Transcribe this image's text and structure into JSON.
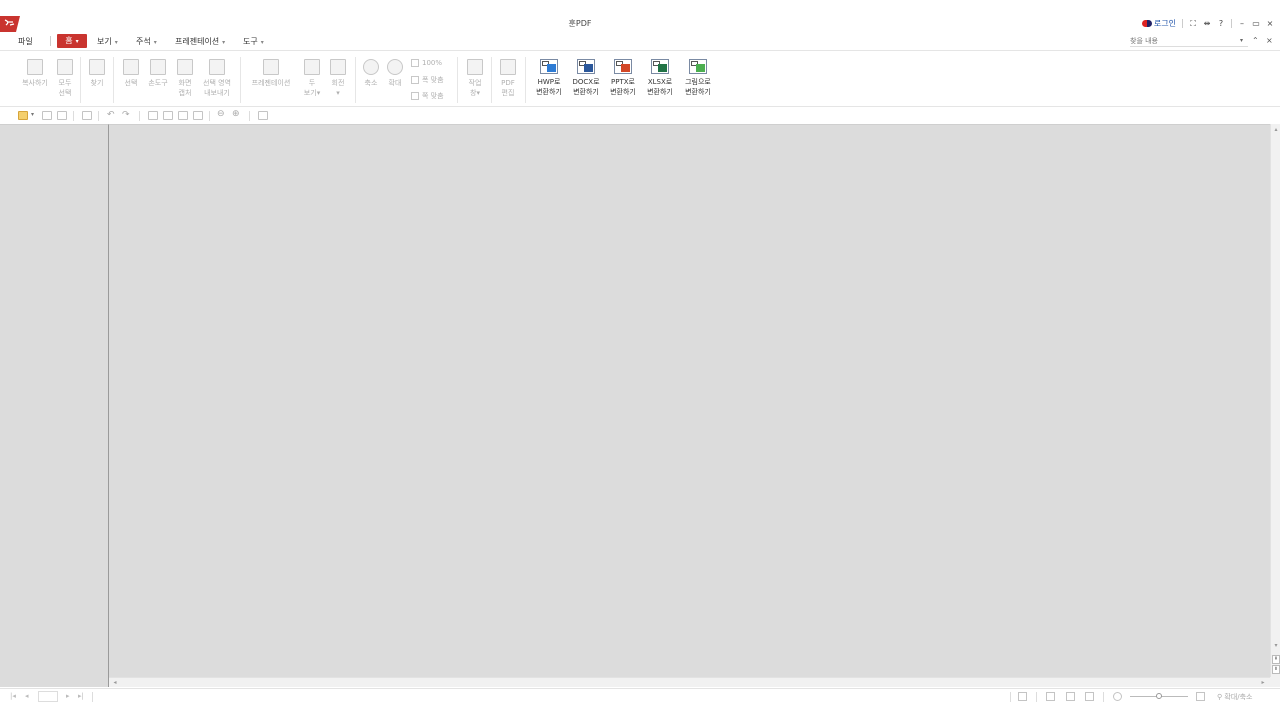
{
  "app": {
    "title": "훈PDF",
    "brand_color": "#c9342f"
  },
  "titlebar": {
    "login_label": "로그인",
    "help_label": "?",
    "minimize": "–",
    "restore": "▭",
    "close": "×"
  },
  "menu": {
    "file": "파일",
    "home": "홈",
    "view": "보기",
    "annotate": "주석",
    "presentation": "프레젠테이션",
    "tools": "도구",
    "search_placeholder": "찾을 내용"
  },
  "ribbon": {
    "copy": "복사하기",
    "select_all": [
      "모두",
      "선택"
    ],
    "find": "찾기",
    "select": "선택",
    "hand_tool": "손도구",
    "snapshot": [
      "화면",
      "캡처"
    ],
    "export_area": [
      "선택 영역",
      "내보내기"
    ],
    "presentation": "프레젠테이션",
    "two_page": [
      "두",
      "보기"
    ],
    "rotate": "회전",
    "zoom_out": "축소",
    "zoom_in": "확대",
    "zoom_100": "100%",
    "fit_width": "폭 맞춤",
    "fit_page": "쪽 맞춤",
    "task_pane": [
      "작업",
      "창"
    ],
    "pdf_edit": [
      "PDF",
      "편집"
    ],
    "convert": [
      {
        "line1": "HWP로",
        "line2": "변환하기",
        "icon": "hwp-icon",
        "color": "#2d7bd4"
      },
      {
        "line1": "DOCX로",
        "line2": "변환하기",
        "icon": "docx-icon",
        "color": "#2b579a"
      },
      {
        "line1": "PPTX로",
        "line2": "변환하기",
        "icon": "pptx-icon",
        "color": "#d24726"
      },
      {
        "line1": "XLSX로",
        "line2": "변환하기",
        "icon": "xlsx-icon",
        "color": "#217346"
      },
      {
        "line1": "그림으로",
        "line2": "변환하기",
        "icon": "image-icon",
        "color": "#4caf50"
      }
    ]
  },
  "statusbar": {
    "zoom_label": "확대/축소"
  }
}
